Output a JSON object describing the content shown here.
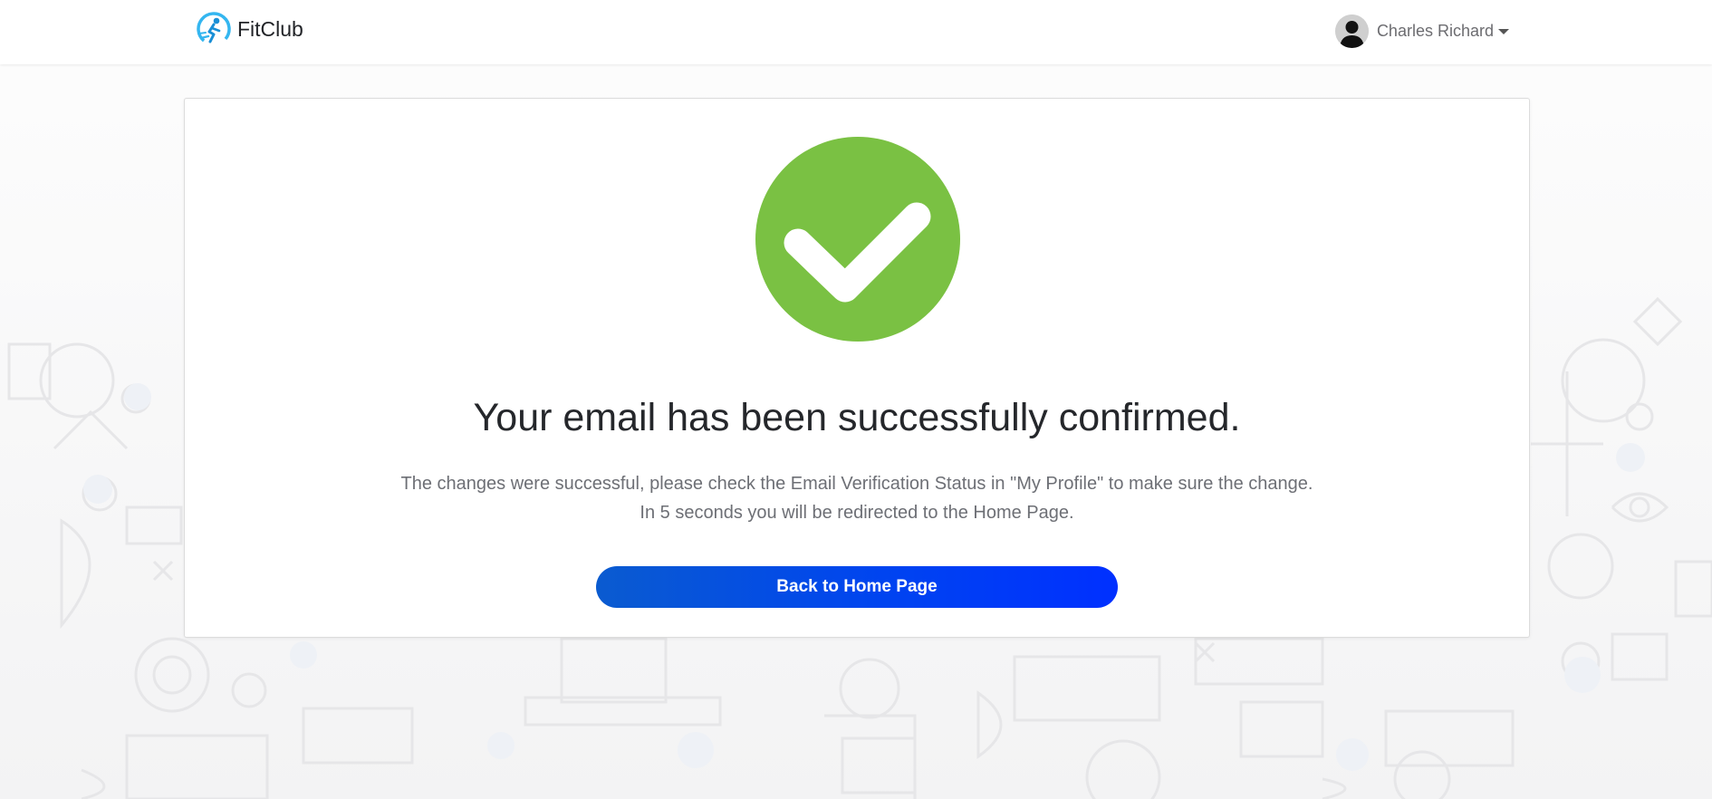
{
  "header": {
    "brand": "FitClub",
    "user_name": "Charles Richard",
    "brand_colors": {
      "primary": "#1a8fd6",
      "accent": "#34b6f0"
    }
  },
  "confirmation": {
    "icon": "check-circle-icon",
    "icon_color": "#7ac143",
    "headline": "Your email has been successfully confirmed.",
    "message_line1": "The changes were successful, please check the Email Verification Status in \"My Profile\" to make sure the change.",
    "message_line2": "In 5 seconds you will be redirected to the Home Page.",
    "button_label": "Back to Home Page",
    "button_color": "#0044f0"
  }
}
